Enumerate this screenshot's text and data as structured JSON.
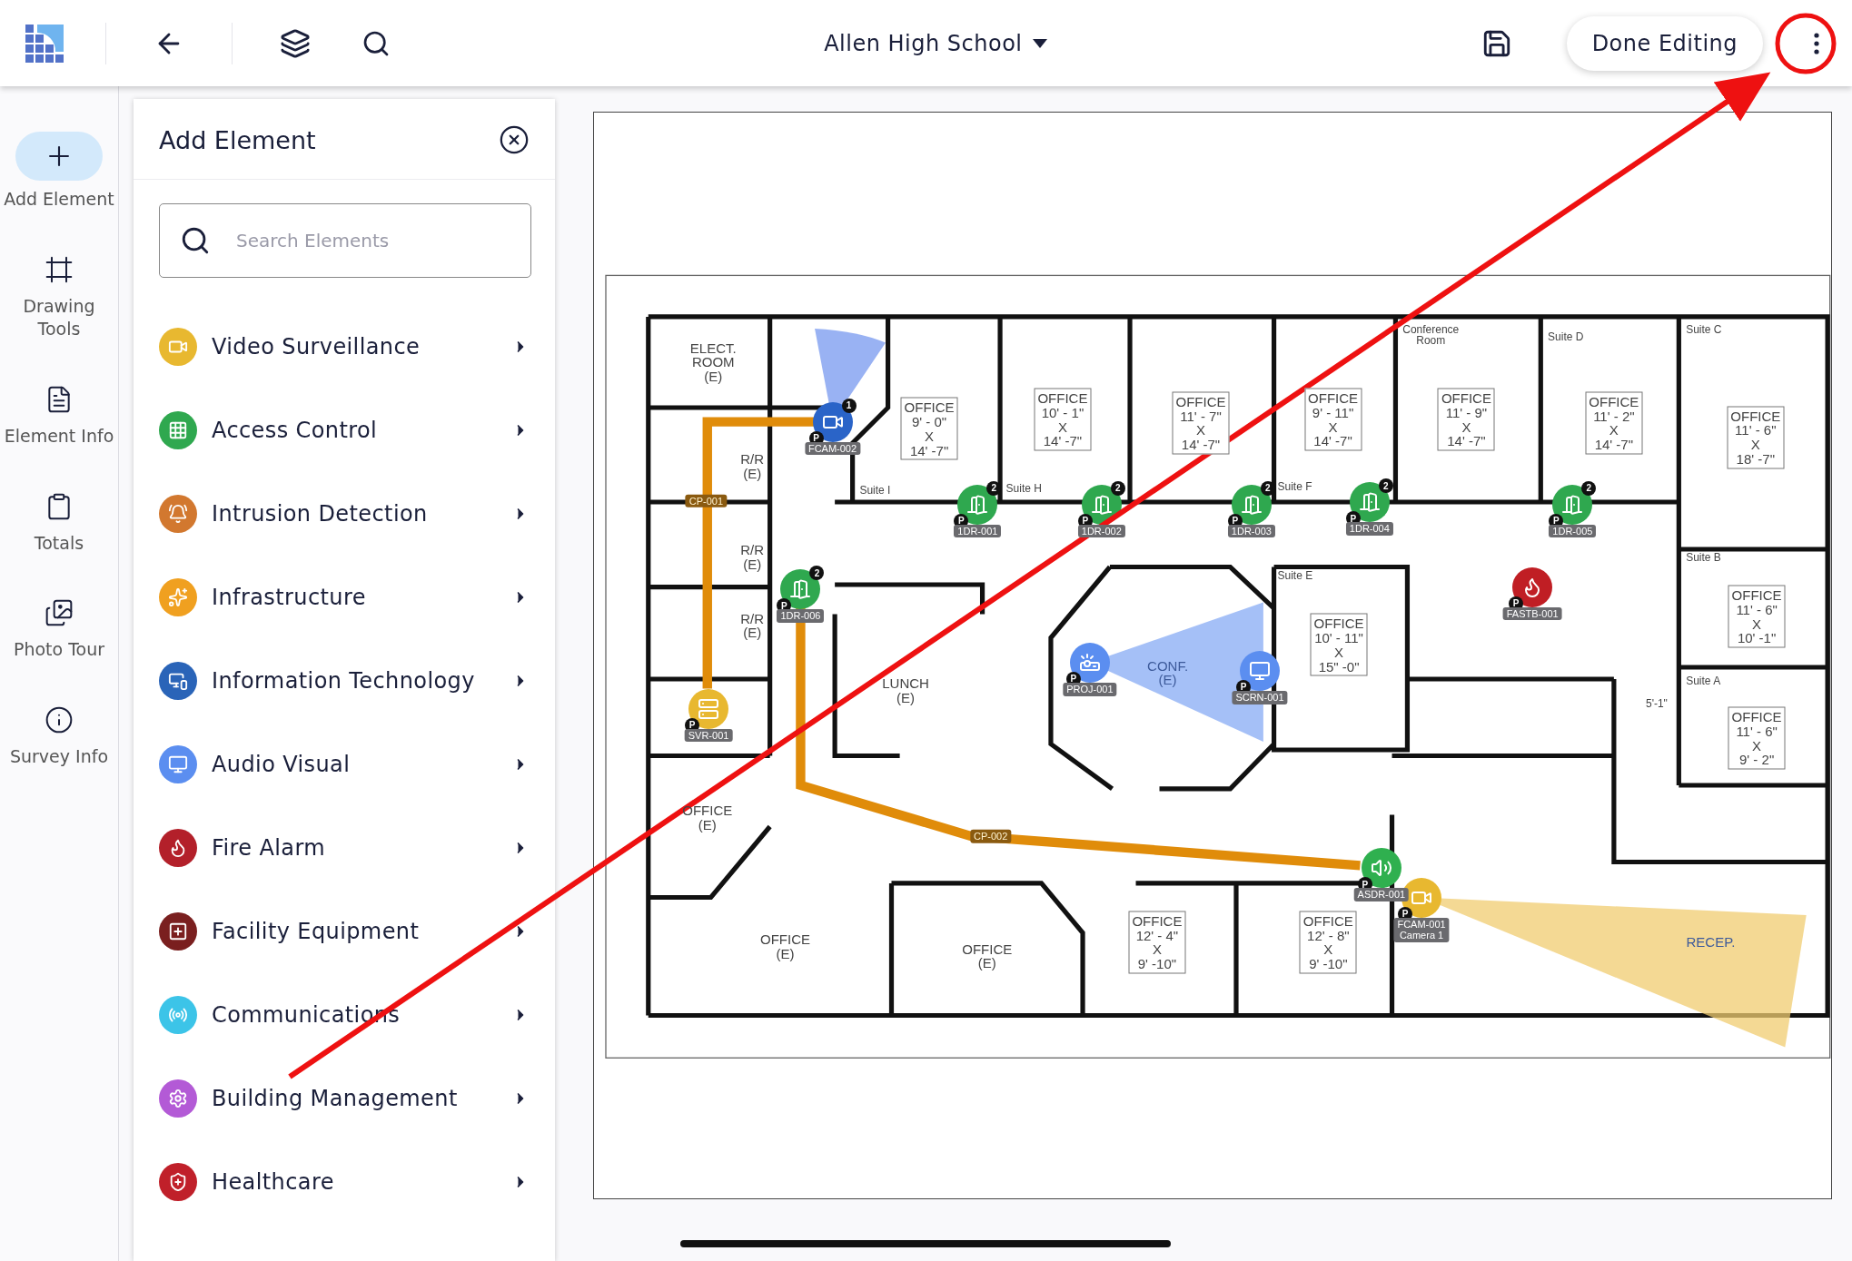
{
  "top_bar": {
    "title": "Allen High School",
    "done_button": "Done Editing"
  },
  "rail": [
    {
      "label": "Add Element",
      "selected": true
    },
    {
      "label": "Drawing Tools",
      "selected": false
    },
    {
      "label": "Element Info",
      "selected": false
    },
    {
      "label": "Totals",
      "selected": false
    },
    {
      "label": "Photo Tour",
      "selected": false
    },
    {
      "label": "Survey Info",
      "selected": false
    }
  ],
  "panel": {
    "title": "Add Element",
    "search": {
      "placeholder": "Search Elements"
    },
    "categories": [
      {
        "label": "Video Surveillance",
        "color": "#e8b830"
      },
      {
        "label": "Access Control",
        "color": "#2fa84f"
      },
      {
        "label": "Intrusion Detection",
        "color": "#d2782f"
      },
      {
        "label": "Infrastructure",
        "color": "#f0a020"
      },
      {
        "label": "Information Technology",
        "color": "#2a64b8"
      },
      {
        "label": "Audio Visual",
        "color": "#5b8ef0"
      },
      {
        "label": "Fire Alarm",
        "color": "#b3202a"
      },
      {
        "label": "Facility Equipment",
        "color": "#7a1f1f"
      },
      {
        "label": "Communications",
        "color": "#3cc4e8"
      },
      {
        "label": "Building Management",
        "color": "#b35ad6"
      },
      {
        "label": "Healthcare",
        "color": "#c0202a"
      }
    ]
  },
  "floor_plan": {
    "rooms": [
      {
        "kind": "plain",
        "lines": [
          "ELECT.",
          "ROOM",
          "(E)"
        ]
      },
      {
        "kind": "plain",
        "lines": [
          "R/R",
          "(E)"
        ]
      },
      {
        "kind": "plain",
        "lines": [
          "R/R",
          "(E)"
        ]
      },
      {
        "kind": "plain",
        "lines": [
          "R/R",
          "(E)"
        ]
      },
      {
        "kind": "boxed",
        "lines": [
          "OFFICE",
          "9' - 0\"",
          "X",
          "14' -7\""
        ]
      },
      {
        "kind": "boxed",
        "lines": [
          "OFFICE",
          "10' - 1\"",
          "X",
          "14' -7\""
        ]
      },
      {
        "kind": "boxed",
        "lines": [
          "OFFICE",
          "11' - 7\"",
          "X",
          "14' -7\""
        ]
      },
      {
        "kind": "boxed",
        "lines": [
          "OFFICE",
          "9' - 11\"",
          "X",
          "14' -7\""
        ]
      },
      {
        "kind": "boxed",
        "lines": [
          "OFFICE",
          "11' - 9\"",
          "X",
          "14' -7\""
        ]
      },
      {
        "kind": "boxed",
        "lines": [
          "OFFICE",
          "11' - 2\"",
          "X",
          "14' -7\""
        ]
      },
      {
        "kind": "boxed",
        "lines": [
          "OFFICE",
          "11' - 6\"",
          "X",
          "18' -7\""
        ]
      },
      {
        "kind": "boxed",
        "lines": [
          "OFFICE",
          "10' - 11\"",
          "X",
          "15\" -0\""
        ]
      },
      {
        "kind": "boxed",
        "lines": [
          "OFFICE",
          "11' - 6\"",
          "X",
          "10' -1\""
        ]
      },
      {
        "kind": "boxed",
        "lines": [
          "OFFICE",
          "11' - 6\"",
          "X",
          "9' - 2\""
        ]
      },
      {
        "kind": "boxed",
        "lines": [
          "OFFICE",
          "12' - 4\"",
          "X",
          "9' -10\""
        ]
      },
      {
        "kind": "boxed",
        "lines": [
          "OFFICE",
          "12' - 8\"",
          "X",
          "9' -10\""
        ]
      },
      {
        "kind": "plain",
        "lines": [
          "LUNCH",
          "(E)"
        ]
      },
      {
        "kind": "faded",
        "lines": [
          "CONF.",
          "(E)"
        ]
      },
      {
        "kind": "plain",
        "lines": [
          "OFFICE",
          "(E)"
        ]
      },
      {
        "kind": "plain",
        "lines": [
          "OFFICE",
          "(E)"
        ]
      },
      {
        "kind": "plain",
        "lines": [
          "OFFICE",
          "(E)"
        ]
      },
      {
        "kind": "faded",
        "lines": [
          "RECEP."
        ]
      },
      {
        "kind": "suite",
        "lines": [
          "Conference",
          "Room"
        ]
      },
      {
        "kind": "suite",
        "lines": [
          "Suite I"
        ]
      },
      {
        "kind": "suite",
        "lines": [
          "Suite H"
        ]
      },
      {
        "kind": "suite",
        "lines": [
          "Suite F"
        ]
      },
      {
        "kind": "suite",
        "lines": [
          "Suite D"
        ]
      },
      {
        "kind": "suite",
        "lines": [
          "Suite C"
        ]
      },
      {
        "kind": "suite",
        "lines": [
          "Suite E"
        ]
      },
      {
        "kind": "suite",
        "lines": [
          "Suite B"
        ]
      },
      {
        "kind": "suite",
        "lines": [
          "Suite A"
        ]
      },
      {
        "kind": "suite",
        "lines": [
          "5'-1\""
        ]
      }
    ],
    "cables": [
      {
        "label": "CP-001"
      },
      {
        "label": "CP-002"
      }
    ],
    "devices": [
      {
        "kind": "camera",
        "color": "#2a64c8",
        "label": "FCAM-002",
        "badge": "P",
        "count": "1"
      },
      {
        "kind": "door",
        "color": "#2fa84f",
        "label": "1DR-001",
        "badge": "P",
        "count": "2"
      },
      {
        "kind": "door",
        "color": "#2fa84f",
        "label": "1DR-002",
        "badge": "P",
        "count": "2"
      },
      {
        "kind": "door",
        "color": "#2fa84f",
        "label": "1DR-003",
        "badge": "P",
        "count": "2"
      },
      {
        "kind": "door",
        "color": "#2fa84f",
        "label": "1DR-004",
        "badge": "P",
        "count": "2"
      },
      {
        "kind": "door",
        "color": "#2fa84f",
        "label": "1DR-005",
        "badge": "P",
        "count": "2"
      },
      {
        "kind": "door",
        "color": "#2fa84f",
        "label": "1DR-006",
        "badge": "P",
        "count": "2"
      },
      {
        "kind": "fire",
        "color": "#c01e24",
        "label": "FASTB-001",
        "badge": "P"
      },
      {
        "kind": "projector",
        "color": "#5b8ef0",
        "label": "PROJ-001",
        "badge": "P"
      },
      {
        "kind": "screen",
        "color": "#5b8ef0",
        "label": "SCRN-001",
        "badge": "P"
      },
      {
        "kind": "server",
        "color": "#e8b830",
        "label": "SVR-001",
        "badge": "P"
      },
      {
        "kind": "speaker",
        "color": "#2fb04f",
        "label": "ASDR-001",
        "badge": "P"
      },
      {
        "kind": "camera",
        "color": "#e8b830",
        "label": "FCAM-001\nCamera 1",
        "badge": "P"
      }
    ]
  }
}
